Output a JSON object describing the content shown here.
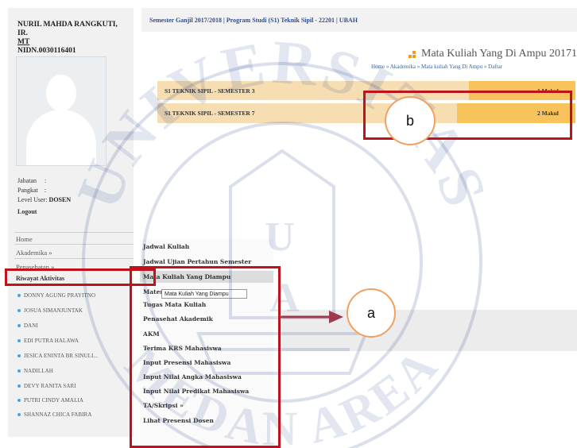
{
  "user": {
    "name_line1": "NURIL MAHDA RANGKUTI, IR.",
    "name_line2": "MT",
    "nidn": "NIDN.0030116401",
    "jabatan_label": "Jabatan",
    "jabatan_sep": ":",
    "pangkat_label": "Pangkat",
    "pangkat_sep": ":",
    "level_label": "Level User:",
    "level_value": "DOSEN",
    "logout": "Logout"
  },
  "left_menu": {
    "home": "Home",
    "akademika": "Akademika »",
    "penasehat": "Penasehatan »",
    "riwayat": "Riwayat Aktivitas"
  },
  "students": [
    "DONNY AGUNG PRAYITNO",
    "JOSUA SIMANJUNTAK",
    "DANI",
    "EDI PUTRA HALAWA",
    "JESICA ENINTA BR SINULI...",
    "NADILLAH",
    "DEVY RANITA SARI",
    "PUTRI CINDY AMALIA",
    "SHANNAZ CHICA FABIRA"
  ],
  "header": {
    "semester_info": "Semester Ganjil 2017/2018 | Program Studi (S1) Teknik Sipil - 22201 | UBAH",
    "page_title": "Mata Kuliah Yang Di Ampu 20171",
    "breadcrumb": "Home » Akademika » Mata kuliah Yang Di Ampu » Daftar"
  },
  "semesters": [
    {
      "label": "S1 TEKNIK SIPIL - SEMESTER 3",
      "count": "1 Makul"
    },
    {
      "label": "S1 TEKNIK SIPIL - SEMESTER 7",
      "count": "2 Makul"
    }
  ],
  "dropdown": {
    "items": [
      "Jadwal Kuliah",
      "Jadwal Ujian Pertahun Semester",
      "Mata Kuliah Yang Diampu",
      "Materi Mata Kuliah",
      "Tugas Mata Kuliah",
      "Penasehat Akademik",
      "AKM",
      "Terima KRS Mahasiswa",
      "Input Presensi Mahasiswa",
      "Input Nilai Angka Mahasiswa",
      "Input Nilai Predikat Mahasiswa",
      "TA/Skripsi »",
      "Lihat Presensi Dosen"
    ],
    "tooltip": "Mata Kuliah Yang Diampu"
  },
  "annotations": {
    "a": "a",
    "b": "b"
  },
  "watermark": {
    "top_text": "UNIVERSITAS",
    "bottom_text": "MEDAN AREA",
    "center_text": "U",
    "center_text2": "A"
  },
  "colors": {
    "bar_light": "#f6ddb2",
    "bar_dark": "#f7c35a",
    "annotation_red": "#c0121b",
    "annotation_circle": "#f0a060"
  }
}
